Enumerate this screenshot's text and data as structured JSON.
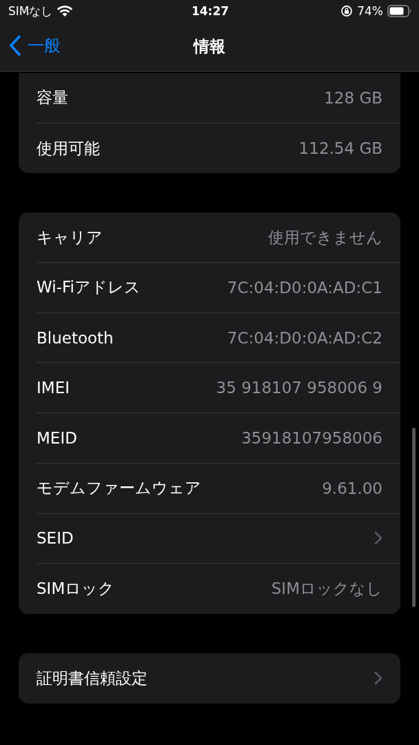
{
  "status_bar": {
    "carrier": "SIMなし",
    "time": "14:27",
    "battery": "74%"
  },
  "nav": {
    "back": "一般",
    "title": "情報"
  },
  "groups": [
    {
      "cut_top": true,
      "rows": [
        {
          "kind": "value",
          "label": "容量",
          "value": "128 GB"
        },
        {
          "kind": "value",
          "label": "使用可能",
          "value": "112.54 GB"
        }
      ]
    },
    {
      "cut_top": false,
      "rows": [
        {
          "kind": "value",
          "label": "キャリア",
          "value": "使用できません"
        },
        {
          "kind": "value",
          "label": "Wi-Fiアドレス",
          "value": "7C:04:D0:0A:AD:C1"
        },
        {
          "kind": "value",
          "label": "Bluetooth",
          "value": "7C:04:D0:0A:AD:C2"
        },
        {
          "kind": "value",
          "label": "IMEI",
          "value": "35 918107 958006 9"
        },
        {
          "kind": "value",
          "label": "MEID",
          "value": "35918107958006"
        },
        {
          "kind": "value",
          "label": "モデムファームウェア",
          "value": "9.61.00"
        },
        {
          "kind": "link",
          "label": "SEID"
        },
        {
          "kind": "value",
          "label": "SIMロック",
          "value": "SIMロックなし"
        }
      ]
    },
    {
      "cut_top": false,
      "rows": [
        {
          "kind": "link",
          "label": "証明書信頼設定"
        }
      ]
    }
  ]
}
